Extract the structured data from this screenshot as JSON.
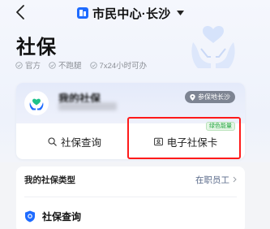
{
  "nav": {
    "title": "市民中心·长沙"
  },
  "header": {
    "title": "社保",
    "tags": [
      "官方",
      "不跑腿",
      "7x24小时可办"
    ]
  },
  "card": {
    "name": "我的社保",
    "location_badge": "参保地长沙",
    "buttons": {
      "query": "社保查询",
      "ecard": "电子社保卡",
      "ecard_badge": "绿色能量"
    }
  },
  "list": {
    "type_label": "我的社保类型",
    "type_value": "在职员工",
    "query_label": "社保查询"
  },
  "colors": {
    "brand_blue": "#1e6bff",
    "highlight_red": "#ff1a1a",
    "badge_green": "#28a745"
  }
}
